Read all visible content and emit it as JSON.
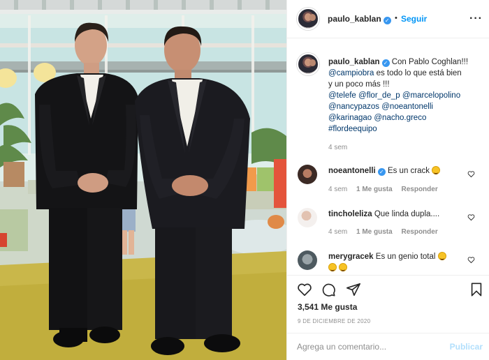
{
  "header": {
    "username": "paulo_kablan",
    "separator": "•",
    "follow_label": "Seguir",
    "more_label": "···"
  },
  "caption": {
    "username": "paulo_kablan",
    "line1": "Con Pablo Coghlan!!!",
    "line2_mention": "@campiobra",
    "line2_text": " es todo lo que está bien",
    "line3": "y un poco más !!!",
    "line4": "@telefe @flor_de_p @marcelopolino",
    "line5": "@nancypazos @noeantonelli",
    "line6": "@karinagao @nacho.greco",
    "line7": "#flordeequipo",
    "time": "4 sem"
  },
  "comments": [
    {
      "username": "noeantonelli",
      "text": "Es un crack",
      "time": "4 sem",
      "likes": "1 Me gusta",
      "reply": "Responder"
    },
    {
      "username": "tincholeliza",
      "text": "Que linda dupla....",
      "time": "4 sem",
      "likes": "1 Me gusta",
      "reply": "Responder"
    },
    {
      "username": "merygracek",
      "text": "Es un genio total"
    }
  ],
  "actions": {
    "likes": "3,541 Me gusta",
    "date": "9 DE DICIEMBRE DE 2020"
  },
  "add_comment": {
    "placeholder": "Agrega un comentario...",
    "publish_label": "Publicar"
  },
  "icons": [
    "heart-icon",
    "comment-icon",
    "share-icon",
    "bookmark-icon",
    "verified-icon",
    "more-icon"
  ],
  "colors": {
    "link": "#0095f6",
    "mention": "#00376b",
    "muted": "#8e8e8e",
    "verified": "#3897f0"
  }
}
